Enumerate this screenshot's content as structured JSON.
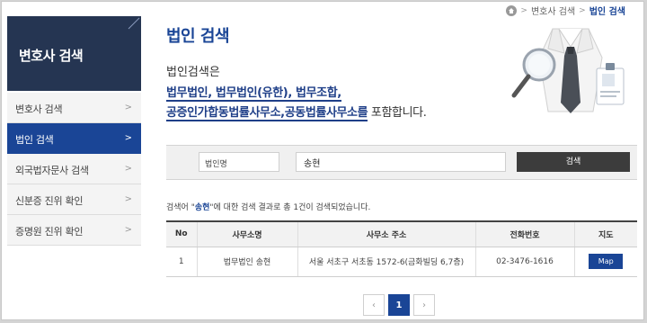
{
  "sidebar": {
    "title": "변호사 검색",
    "items": [
      {
        "label": "변호사 검색",
        "active": false
      },
      {
        "label": "법인 검색",
        "active": true
      },
      {
        "label": "외국법자문사 검색",
        "active": false
      },
      {
        "label": "신분증 진위 확인",
        "active": false
      },
      {
        "label": "증명원 진위 확인",
        "active": false
      }
    ]
  },
  "breadcrumb": {
    "home_icon": "home-icon",
    "items": [
      "변호사 검색",
      "법인 검색"
    ]
  },
  "main": {
    "title": "법인 검색",
    "intro": {
      "lead": "법인검색은",
      "line1": "법무법인, 법무법인(유한), 법무조합,",
      "line2_underlined": "공증인가합동법률사무소,공동법률사무소를",
      "line2_tail": " 포함합니다."
    }
  },
  "search": {
    "select_value": "법인명",
    "input_value": "송현",
    "button_label": "검색"
  },
  "result": {
    "summary_prefix": "검색어 \"",
    "keyword": "송현",
    "summary_suffix": "\"에 대한 검색 결과로 총 1건이 검색되었습니다."
  },
  "table": {
    "headers": [
      "No",
      "사무소명",
      "사무소 주소",
      "전화번호",
      "지도"
    ],
    "rows": [
      {
        "no": "1",
        "name": "법무법인 송현",
        "address": "서울 서초구 서초동 1572-6(금화빌딩 6,7층)",
        "phone": "02-3476-1616",
        "map_label": "Map"
      }
    ]
  },
  "pagination": {
    "prev": "‹",
    "current": "1",
    "next": "›"
  },
  "colors": {
    "sidebar_header": "#253552",
    "accent": "#1a4596",
    "search_button": "#3c3c3c"
  }
}
